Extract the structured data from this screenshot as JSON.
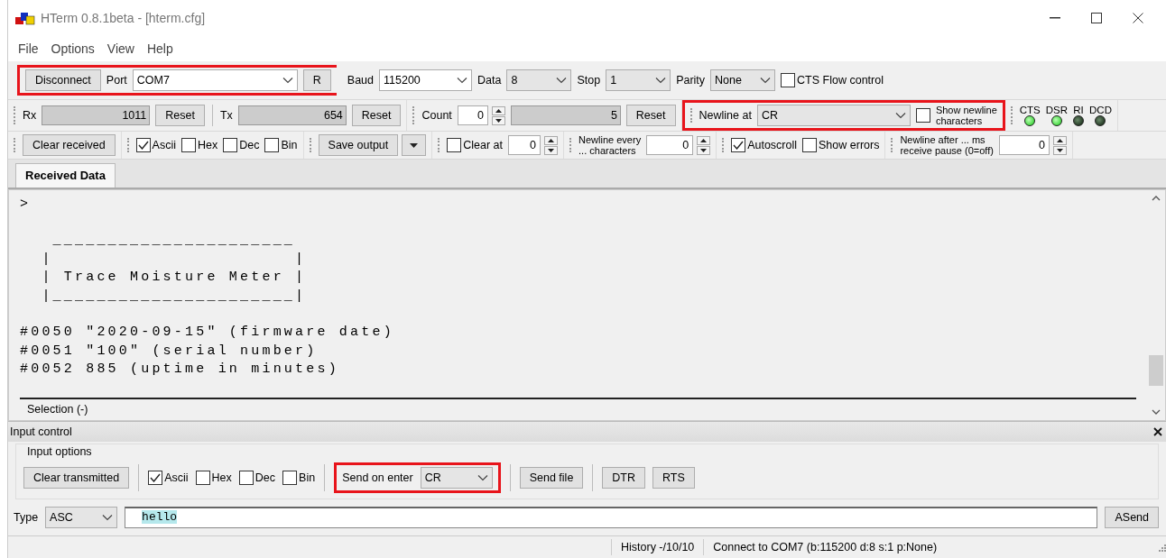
{
  "window": {
    "title": "HTerm 0.8.1beta - [hterm.cfg]"
  },
  "menu": [
    "File",
    "Options",
    "View",
    "Help"
  ],
  "toolbars": [
    {
      "groups": [
        {
          "grip": false,
          "highlighted": true,
          "items": [
            {
              "kind": "button",
              "label": "Disconnect"
            },
            {
              "kind": "label",
              "text": "Port"
            },
            {
              "kind": "combo",
              "value": "COM7",
              "disabled": false
            },
            {
              "kind": "button",
              "label": "R"
            }
          ]
        },
        {
          "grip": false,
          "highlighted": false,
          "items": [
            {
              "kind": "label",
              "text": "Baud"
            },
            {
              "kind": "combo",
              "value": "115200",
              "disabled": false
            },
            {
              "kind": "label",
              "text": "Data"
            },
            {
              "kind": "combo",
              "value": "8",
              "disabled": true
            },
            {
              "kind": "label",
              "text": "Stop"
            },
            {
              "kind": "combo",
              "value": "1",
              "disabled": true
            },
            {
              "kind": "label",
              "text": "Parity"
            },
            {
              "kind": "combo",
              "value": "None",
              "disabled": true
            },
            {
              "kind": "check",
              "label": "CTS Flow control",
              "checked": false
            }
          ]
        }
      ]
    },
    {
      "groups": [
        {
          "grip": true,
          "highlighted": false,
          "items": [
            {
              "kind": "label",
              "text": "Rx"
            },
            {
              "kind": "readout",
              "value": "1011"
            },
            {
              "kind": "button",
              "label": "Reset"
            },
            {
              "kind": "sep"
            },
            {
              "kind": "label",
              "text": "Tx"
            },
            {
              "kind": "readout",
              "value": "654"
            },
            {
              "kind": "button",
              "label": "Reset"
            }
          ]
        },
        {
          "grip": true,
          "highlighted": false,
          "items": [
            {
              "kind": "label",
              "text": "Count"
            },
            {
              "kind": "spin",
              "value": "0"
            },
            {
              "kind": "readout",
              "value": "5"
            },
            {
              "kind": "button",
              "label": "Reset"
            }
          ]
        },
        {
          "grip": true,
          "highlighted": true,
          "items": [
            {
              "kind": "label",
              "text": "Newline at"
            },
            {
              "kind": "combo",
              "value": "CR",
              "disabled": true
            },
            {
              "kind": "check2",
              "lines": [
                "Show newline",
                "characters"
              ],
              "checked": false
            }
          ]
        },
        {
          "grip": true,
          "highlighted": false,
          "items": [
            {
              "kind": "led",
              "label": "CTS",
              "on": true
            },
            {
              "kind": "led",
              "label": "DSR",
              "on": true
            },
            {
              "kind": "led",
              "label": "RI",
              "on": false
            },
            {
              "kind": "led",
              "label": "DCD",
              "on": false
            }
          ]
        }
      ]
    },
    {
      "groups": [
        {
          "grip": true,
          "highlighted": false,
          "items": [
            {
              "kind": "button",
              "label": "Clear received"
            }
          ]
        },
        {
          "grip": true,
          "highlighted": false,
          "items": [
            {
              "kind": "check",
              "label": "Ascii",
              "checked": true
            },
            {
              "kind": "check",
              "label": "Hex",
              "checked": false
            },
            {
              "kind": "check",
              "label": "Dec",
              "checked": false
            },
            {
              "kind": "check",
              "label": "Bin",
              "checked": false
            }
          ]
        },
        {
          "grip": true,
          "highlighted": false,
          "items": [
            {
              "kind": "split",
              "label": "Save output"
            }
          ]
        },
        {
          "grip": true,
          "highlighted": false,
          "items": [
            {
              "kind": "check",
              "label": "Clear at",
              "checked": false
            },
            {
              "kind": "spin",
              "value": "0"
            }
          ]
        },
        {
          "grip": true,
          "highlighted": false,
          "items": [
            {
              "kind": "label2",
              "lines": [
                "Newline every",
                "... characters"
              ]
            },
            {
              "kind": "spin",
              "value": "0"
            }
          ]
        },
        {
          "grip": true,
          "highlighted": false,
          "items": [
            {
              "kind": "check",
              "label": "Autoscroll",
              "checked": true
            },
            {
              "kind": "check",
              "label": "Show errors",
              "checked": false
            }
          ]
        },
        {
          "grip": true,
          "highlighted": false,
          "items": [
            {
              "kind": "label2",
              "lines": [
                "Newline after ... ms",
                "receive pause (0=off)"
              ]
            },
            {
              "kind": "spin",
              "value": "0"
            }
          ]
        }
      ]
    }
  ],
  "tabs": [
    {
      "label": "Received Data",
      "selected": true
    }
  ],
  "terminal": {
    "lines": [
      {
        "text": ">",
        "blank_before": false
      },
      {
        "text": "   ______________________",
        "blank_before": true
      },
      {
        "text": "  |                      |",
        "blank_before": false
      },
      {
        "text": "  | Trace Moisture Meter |",
        "blank_before": false
      },
      {
        "text": "  |______________________|",
        "blank_before": false
      },
      {
        "text": "#0050 \"2020-09-15\" (firmware date)",
        "blank_before": true
      },
      {
        "text": "#0051 \"100\" (serial number)",
        "blank_before": false
      },
      {
        "text": "#0052 885 (uptime in minutes)",
        "blank_before": false
      }
    ],
    "selection": "Selection (-)"
  },
  "input_control": {
    "title": "Input control",
    "options_title": "Input options",
    "items": [
      {
        "kind": "button",
        "label": "Clear transmitted"
      },
      {
        "kind": "sep"
      },
      {
        "kind": "check",
        "label": "Ascii",
        "checked": true
      },
      {
        "kind": "check",
        "label": "Hex",
        "checked": false
      },
      {
        "kind": "check",
        "label": "Dec",
        "checked": false
      },
      {
        "kind": "check",
        "label": "Bin",
        "checked": false
      },
      {
        "kind": "sep"
      },
      {
        "kind": "group",
        "highlighted": true,
        "items": [
          {
            "kind": "label",
            "text": "Send on enter"
          },
          {
            "kind": "combo",
            "value": "CR",
            "disabled": true
          }
        ]
      },
      {
        "kind": "sep"
      },
      {
        "kind": "button",
        "label": "Send file"
      },
      {
        "kind": "sep"
      },
      {
        "kind": "button",
        "label": "DTR"
      },
      {
        "kind": "button",
        "label": "RTS"
      }
    ],
    "type_label": "Type",
    "type_value": "ASC",
    "input_value": "hello",
    "send": "ASend"
  },
  "status_bar": [
    "History -/10/10",
    "Connect to COM7 (b:115200 d:8 s:1 p:None)"
  ]
}
